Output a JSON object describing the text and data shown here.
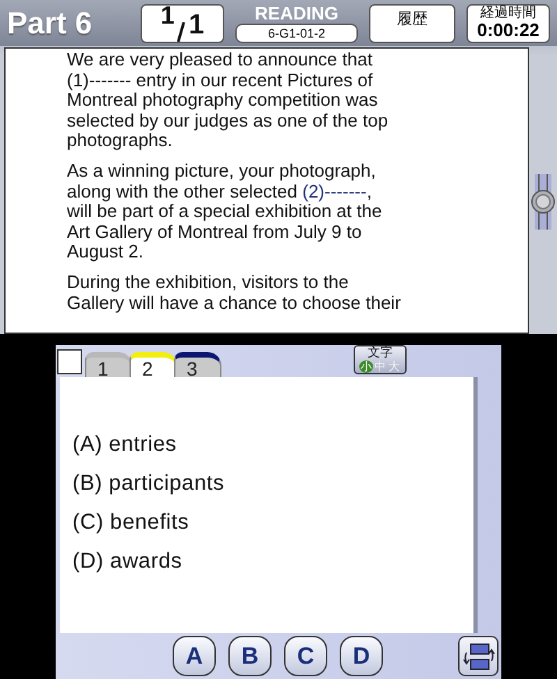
{
  "header": {
    "part": "Part 6",
    "page": {
      "current": "1",
      "total": "1"
    },
    "section": "READING",
    "question_id": "6-G1-01-2",
    "history_button": "履歴",
    "timer": {
      "label": "経過時間",
      "value": "0:00:22"
    }
  },
  "passage": {
    "paragraphs": [
      {
        "lines": [
          [
            {
              "text": "We are very pleased to announce that",
              "highlighted": false
            }
          ],
          [
            {
              "text": "(1)------- entry in our recent Pictures of",
              "highlighted": false
            }
          ],
          [
            {
              "text": "Montreal photography competition was",
              "highlighted": false
            }
          ],
          [
            {
              "text": "selected by our judges as one of the top",
              "highlighted": false
            }
          ],
          [
            {
              "text": "photographs.",
              "highlighted": false
            }
          ]
        ]
      },
      {
        "lines": [
          [
            {
              "text": "As a winning picture, your photograph,",
              "highlighted": false
            }
          ],
          [
            {
              "text": "along with the other selected ",
              "highlighted": false
            },
            {
              "text": "(2)-------",
              "highlighted": true
            },
            {
              "text": ",",
              "highlighted": false
            }
          ],
          [
            {
              "text": "will be part of a special exhibition at the",
              "highlighted": false
            }
          ],
          [
            {
              "text": "Art Gallery of Montreal from July 9 to",
              "highlighted": false
            }
          ],
          [
            {
              "text": "August 2.",
              "highlighted": false
            }
          ]
        ]
      },
      {
        "lines": [
          [
            {
              "text": "During the exhibition, visitors to the",
              "highlighted": false
            }
          ],
          [
            {
              "text": "Gallery will have a chance to choose their",
              "highlighted": false
            }
          ]
        ]
      }
    ]
  },
  "answer_panel": {
    "marked": false,
    "tabs": [
      {
        "label": "1",
        "selected": false,
        "color": "#b8b8b8"
      },
      {
        "label": "2",
        "selected": true,
        "color": "#f2ee10"
      },
      {
        "label": "3",
        "selected": false,
        "color": "#0c1670"
      }
    ],
    "text_size": {
      "label": "文字",
      "options": [
        {
          "label": "小",
          "selected": true
        },
        {
          "label": "中",
          "selected": false
        },
        {
          "label": "大",
          "selected": false
        }
      ]
    },
    "choices": [
      "(A) entries",
      "(B) participants",
      "(C) benefits",
      "(D) awards"
    ]
  },
  "answer_buttons": [
    "A",
    "B",
    "C",
    "D"
  ]
}
